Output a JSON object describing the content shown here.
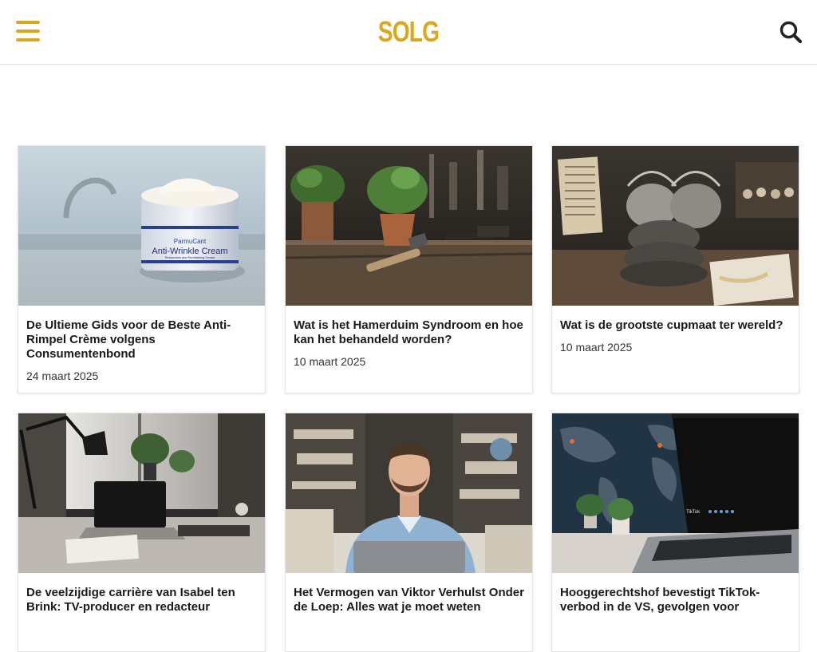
{
  "site": {
    "logo_text": "SOLG",
    "brand_color": "#d9a81e"
  },
  "header": {
    "menu_icon": "hamburger-menu-icon",
    "search_icon": "search-icon"
  },
  "articles": [
    {
      "title": "De Ultieme Gids voor de Beste Anti-Rimpel Crème volgens Consumentenbond",
      "date": "24 maart 2025",
      "image": "anti-wrinkle-cream-jar-photo",
      "image_text": [
        "ParmuCant",
        "Anti-Wrinkle Cream",
        "Restorative and Revitalising Cream"
      ]
    },
    {
      "title": "Wat is het Hamerduim Syndroom en hoe kan het behandeld worden?",
      "date": "10 maart 2025",
      "image": "workbench-plants-hammer-photo"
    },
    {
      "title": "Wat is de grootste cupmaat ter wereld?",
      "date": "10 maart 2025",
      "image": "bras-on-table-photo"
    },
    {
      "title": "De veelzijdige carrière van Isabel ten Brink: TV-producer en redacteur",
      "date": "",
      "image": "desk-laptop-lamp-photo"
    },
    {
      "title": "Het Vermogen van Viktor Verhulst Onder de Loep: Alles wat je moet weten",
      "date": "",
      "image": "man-at-laptop-photo"
    },
    {
      "title": "Hooggerechtshof bevestigt TikTok-verbod in de VS, gevolgen voor",
      "date": "",
      "image": "laptop-tiktok-world-map-photo",
      "image_text": [
        "TikTok"
      ]
    }
  ]
}
